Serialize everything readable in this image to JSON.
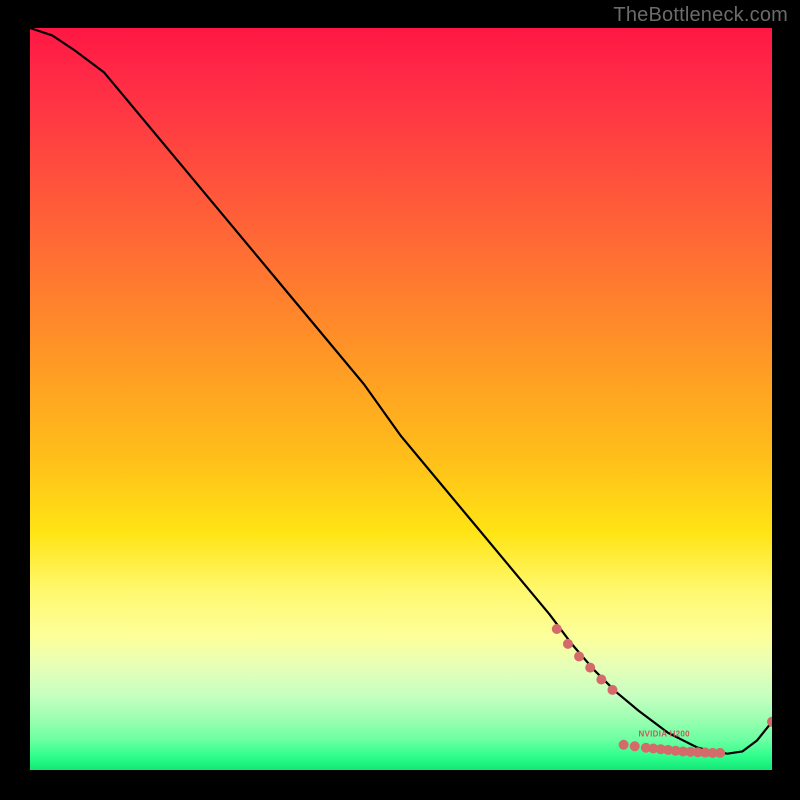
{
  "watermark": "TheBottleneck.com",
  "colors": {
    "background": "#000000",
    "curve": "#000000",
    "marker": "#d46a6a",
    "watermark_text": "#6b6b6b"
  },
  "small_label": "NVIDIA H200",
  "chart_data": {
    "type": "line",
    "title": "",
    "xlabel": "",
    "ylabel": "",
    "xlim": [
      0,
      100
    ],
    "ylim": [
      0,
      100
    ],
    "curve": {
      "x": [
        0,
        3,
        6,
        10,
        15,
        20,
        25,
        30,
        35,
        40,
        45,
        50,
        55,
        60,
        65,
        70,
        73,
        76,
        79,
        82,
        84,
        86,
        88,
        90,
        92,
        94,
        96,
        98,
        100
      ],
      "y": [
        100,
        99,
        97,
        94,
        88,
        82,
        76,
        70,
        64,
        58,
        52,
        45,
        39,
        33,
        27,
        21,
        17,
        13.5,
        10.5,
        8,
        6.5,
        5,
        4,
        3,
        2.5,
        2.2,
        2.5,
        4,
        6.5
      ]
    },
    "markers": [
      {
        "x": 71,
        "y": 19
      },
      {
        "x": 72.5,
        "y": 17
      },
      {
        "x": 74,
        "y": 15.3
      },
      {
        "x": 75.5,
        "y": 13.8
      },
      {
        "x": 77,
        "y": 12.2
      },
      {
        "x": 78.5,
        "y": 10.8
      },
      {
        "x": 80,
        "y": 3.4
      },
      {
        "x": 81.5,
        "y": 3.2
      },
      {
        "x": 83,
        "y": 3.0
      },
      {
        "x": 84,
        "y": 2.9
      },
      {
        "x": 85,
        "y": 2.8
      },
      {
        "x": 86,
        "y": 2.7
      },
      {
        "x": 87,
        "y": 2.6
      },
      {
        "x": 88,
        "y": 2.5
      },
      {
        "x": 89,
        "y": 2.45
      },
      {
        "x": 90,
        "y": 2.4
      },
      {
        "x": 91,
        "y": 2.35
      },
      {
        "x": 92,
        "y": 2.3
      },
      {
        "x": 93,
        "y": 2.3
      },
      {
        "x": 100,
        "y": 6.5
      }
    ],
    "label_position": {
      "x": 82,
      "y": 4.5
    }
  }
}
